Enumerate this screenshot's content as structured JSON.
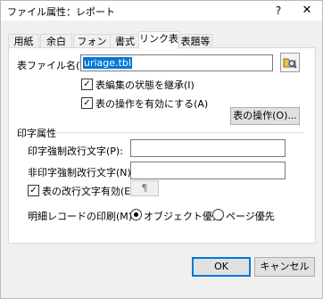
{
  "window": {
    "title": "ファイル属性：レポート",
    "help": "?",
    "close": "✕"
  },
  "tabs": [
    {
      "label": "用紙"
    },
    {
      "label": "余白"
    },
    {
      "label": "フォント"
    },
    {
      "label": "書式"
    },
    {
      "label": "リンク表"
    },
    {
      "label": "表題等"
    }
  ],
  "active_tab": "リンク表",
  "link": {
    "file_label": "表ファイル名(T):",
    "file_value": "uriage.tbl",
    "browse_icon": "browse-folder-icon",
    "inherit_state": {
      "label": "表編集の状態を継承(I)",
      "checked": true
    },
    "enable_ops": {
      "label": "表の操作を有効にする(A)",
      "checked": true
    },
    "ops_button": "表の操作(O)..."
  },
  "print": {
    "group_title": "印字属性",
    "forced_newline_label": "印字強制改行文字(P):",
    "forced_newline_value": "",
    "non_forced_newline_label": "非印字強制改行文字(N):",
    "non_forced_newline_value": "",
    "table_newline": {
      "label": "表の改行文字有効(E):",
      "checked": true,
      "value": "¶"
    },
    "detail_label": "明細レコードの印刷(M):",
    "detail_options": [
      {
        "label": "オブジェクト優先",
        "selected": true
      },
      {
        "label": "ページ優先",
        "selected": false
      }
    ]
  },
  "footer": {
    "ok": "OK",
    "cancel": "キャンセル"
  }
}
